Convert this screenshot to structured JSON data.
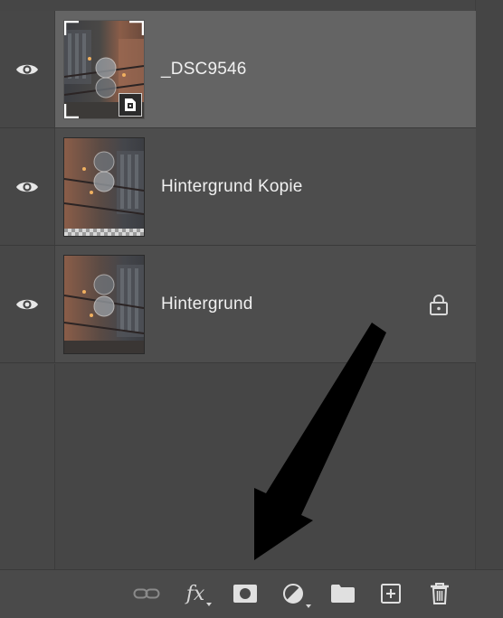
{
  "layers": [
    {
      "name": "_DSC9546",
      "selected": true,
      "smart_object": true,
      "locked": false
    },
    {
      "name": "Hintergrund Kopie",
      "selected": false,
      "smart_object": false,
      "locked": false
    },
    {
      "name": "Hintergrund",
      "selected": false,
      "smart_object": false,
      "locked": true
    }
  ],
  "toolbar": {
    "buttons": [
      "link-layers",
      "fx",
      "add-mask",
      "adjustment-layer",
      "new-group",
      "new-layer",
      "delete-layer"
    ],
    "fx_label": "fx"
  },
  "colors": {
    "panel_bg": "#464646",
    "selected_row": "#646464",
    "row_bg": "#4d4d4d",
    "text": "#f0f0f0"
  }
}
